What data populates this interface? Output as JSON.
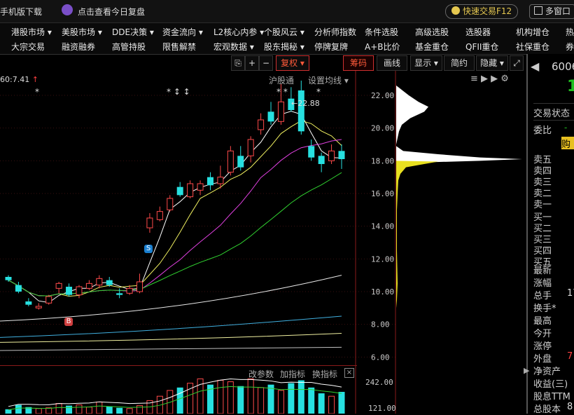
{
  "topbar": {
    "mobile_download": "手机版下载",
    "review_today": "点击查看今日复盘",
    "quick_trade": "快速交易F12",
    "multi_window": "多窗口"
  },
  "menu": {
    "row1": [
      "港股市场",
      "美股市场",
      "DDE决策",
      "资金流向",
      "L2核心内参",
      "个股风云",
      "分析师指数",
      "条件选股",
      "高级选股",
      "选股器",
      "机构增仓",
      "热"
    ],
    "row2": [
      "大宗交易",
      "融资融券",
      "高管持股",
      "限售解禁",
      "宏观数据",
      "股东揭秘",
      "停牌复牌",
      "A+B比价",
      "基金重仓",
      "QFII重仓",
      "社保重仓",
      "券"
    ]
  },
  "toolbar": {
    "restore": "复权",
    "chips": "筹码",
    "draw": "画线",
    "display": "显示",
    "simple": "简约",
    "hide": "隐藏"
  },
  "chart_header": {
    "price_info": "60:7.41",
    "shanghai_connect": "沪股通",
    "ma_settings": "设置均线"
  },
  "indicator_bar": {
    "change_params": "改参数",
    "add_indicator": "加指标",
    "switch_indicator": "换指标"
  },
  "chart_data": {
    "type": "candlestick",
    "ylim": [
      5.5,
      23.5
    ],
    "yticks": [
      6.0,
      8.0,
      10.0,
      12.0,
      14.0,
      16.0,
      18.0,
      20.0,
      22.0
    ],
    "ytick_labels": [
      "6.00",
      "8.00",
      "10.00",
      "12.00",
      "14.00",
      "16.00",
      "18.00",
      "20.00",
      "22.00"
    ],
    "high_marker": "22.88",
    "volume_ticks": [
      "242.00",
      "121.00"
    ],
    "candles": [
      {
        "o": 10.9,
        "h": 11.0,
        "l": 10.6,
        "c": 10.7
      },
      {
        "o": 10.4,
        "h": 10.6,
        "l": 9.9,
        "c": 10.0
      },
      {
        "o": 9.4,
        "h": 9.6,
        "l": 9.1,
        "c": 9.2
      },
      {
        "o": 9.0,
        "h": 9.3,
        "l": 8.9,
        "c": 9.1
      },
      {
        "o": 9.3,
        "h": 9.8,
        "l": 9.2,
        "c": 9.7
      },
      {
        "o": 10.2,
        "h": 10.6,
        "l": 9.9,
        "c": 10.5
      },
      {
        "o": 10.3,
        "h": 10.5,
        "l": 9.7,
        "c": 9.8
      },
      {
        "o": 9.8,
        "h": 10.4,
        "l": 9.6,
        "c": 10.3
      },
      {
        "o": 10.2,
        "h": 10.7,
        "l": 10.1,
        "c": 10.5
      },
      {
        "o": 10.4,
        "h": 11.0,
        "l": 10.2,
        "c": 10.8
      },
      {
        "o": 10.7,
        "h": 10.9,
        "l": 10.3,
        "c": 10.4
      },
      {
        "o": 9.9,
        "h": 10.2,
        "l": 9.6,
        "c": 9.8
      },
      {
        "o": 9.9,
        "h": 10.4,
        "l": 9.8,
        "c": 10.2
      },
      {
        "o": 10.0,
        "h": 11.1,
        "l": 9.9,
        "c": 10.6
      },
      {
        "o": 13.9,
        "h": 14.8,
        "l": 13.6,
        "c": 14.5
      },
      {
        "o": 14.4,
        "h": 15.2,
        "l": 14.3,
        "c": 14.9
      },
      {
        "o": 15.0,
        "h": 15.9,
        "l": 14.9,
        "c": 15.7
      },
      {
        "o": 16.4,
        "h": 16.7,
        "l": 15.8,
        "c": 15.9
      },
      {
        "o": 15.8,
        "h": 16.8,
        "l": 15.7,
        "c": 16.6
      },
      {
        "o": 16.2,
        "h": 16.8,
        "l": 15.9,
        "c": 16.6
      },
      {
        "o": 17.0,
        "h": 17.3,
        "l": 16.2,
        "c": 16.5
      },
      {
        "o": 16.6,
        "h": 17.7,
        "l": 16.3,
        "c": 17.0
      },
      {
        "o": 17.3,
        "h": 18.9,
        "l": 17.1,
        "c": 18.6
      },
      {
        "o": 18.3,
        "h": 18.9,
        "l": 17.4,
        "c": 17.6
      },
      {
        "o": 18.3,
        "h": 19.5,
        "l": 17.9,
        "c": 19.3
      },
      {
        "o": 19.9,
        "h": 20.9,
        "l": 19.6,
        "c": 20.5
      },
      {
        "o": 21.0,
        "h": 21.6,
        "l": 20.2,
        "c": 20.4
      },
      {
        "o": 20.4,
        "h": 22.7,
        "l": 20.2,
        "c": 21.6
      },
      {
        "o": 21.8,
        "h": 22.5,
        "l": 21.0,
        "c": 21.1
      },
      {
        "o": 22.3,
        "h": 22.9,
        "l": 19.6,
        "c": 19.8
      },
      {
        "o": 18.9,
        "h": 19.3,
        "l": 18.0,
        "c": 18.2
      },
      {
        "o": 18.3,
        "h": 18.5,
        "l": 17.3,
        "c": 17.8
      },
      {
        "o": 18.0,
        "h": 19.0,
        "l": 17.8,
        "c": 18.6
      },
      {
        "o": 18.6,
        "h": 19.0,
        "l": 17.5,
        "c": 18.1
      }
    ],
    "volume": [
      30,
      60,
      45,
      35,
      40,
      70,
      55,
      60,
      45,
      80,
      50,
      40,
      35,
      55,
      90,
      120,
      160,
      180,
      210,
      240,
      200,
      230,
      220,
      190,
      240,
      180,
      200,
      160,
      210,
      230,
      180,
      140,
      120,
      150
    ]
  },
  "right_panel": {
    "code": "6006",
    "price": "1",
    "trade_status": "交易状态",
    "ratio_label": "委比",
    "ratio_value": "-",
    "buy_label": "购",
    "sell_levels": [
      "卖五",
      "卖四",
      "卖三",
      "卖二",
      "卖一"
    ],
    "buy_levels": [
      "买一",
      "买二",
      "买三",
      "买四",
      "买五"
    ],
    "stats": [
      "最新",
      "涨幅",
      "总手",
      "换手*",
      "最高",
      "今开",
      "涨停",
      "外盘",
      "净资产",
      "收益(三)",
      "股息TTM",
      "总股本"
    ],
    "stat_values": [
      "",
      "",
      "17",
      "",
      "",
      "",
      "",
      "7",
      "",
      "",
      "",
      "8"
    ]
  },
  "markers": {
    "S": "S",
    "B": "B"
  }
}
